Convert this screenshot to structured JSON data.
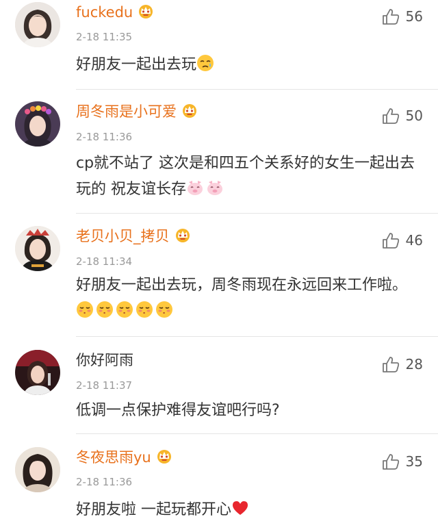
{
  "comments": [
    {
      "username": "fuckedu",
      "vip": true,
      "time": "2-18 11:35",
      "text": "好朋友一起出去玩",
      "likes": "56",
      "emoji_name": "sleepy-face-emoji",
      "emoji_count": 1
    },
    {
      "username": "周冬雨是小可爱",
      "vip": true,
      "time": "2-18 11:36",
      "text": "cp就不站了 这次是和四五个关系好的女生一起出去玩的 祝友谊长存",
      "likes": "50",
      "emoji_name": "pink-pig-face-emoji",
      "emoji_count": 2
    },
    {
      "username": "老贝小贝_拷贝",
      "vip": true,
      "time": "2-18 11:34",
      "text": "好朋友一起出去玩，周冬雨现在永远回来工作啦。",
      "likes": "46",
      "emoji_name": "kissing-face-emoji",
      "emoji_count": 5
    },
    {
      "username": "你好阿雨",
      "vip": false,
      "time": "2-18 11:37",
      "text": "低调一点保护难得友谊吧行吗?",
      "likes": "28",
      "emoji_count": 0
    },
    {
      "username": "冬夜思雨yu",
      "vip": true,
      "time": "2-18 11:36",
      "text": "好朋友啦 一起玩都开心",
      "likes": "35",
      "emoji_name": "red-heart-emoji",
      "emoji_count": 1
    }
  ],
  "icons": {
    "like": "thumbs-up-icon",
    "vip": "vip-crown-badge-icon"
  },
  "colors": {
    "vip_name": "#e8711c",
    "plain_name": "#333333",
    "time": "#999999",
    "text": "#333333",
    "divider": "#e5e5e5"
  }
}
